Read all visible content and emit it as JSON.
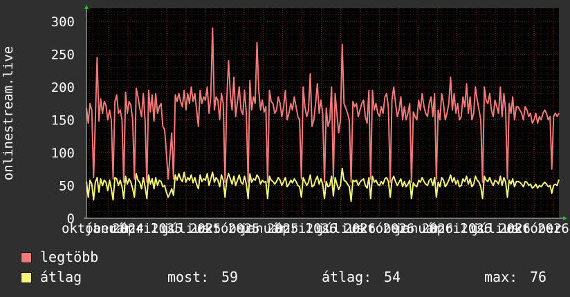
{
  "chart_data": {
    "type": "line",
    "ylabel": "onlinestream.live",
    "ylim": [
      0,
      320
    ],
    "yticks": [
      0,
      50,
      100,
      150,
      200,
      250,
      300
    ],
    "xticks": [
      "október",
      "január",
      "2024",
      "április",
      "2025",
      "július",
      "2025",
      "október",
      "2025",
      "január",
      "2025",
      "április",
      "2026",
      "július",
      "2026",
      "október",
      "2026",
      "január",
      "2026",
      "április",
      "2026",
      "július",
      "2026",
      "október",
      "2026"
    ],
    "grid": true,
    "colors": {
      "max": "#f07a7a",
      "avg": "#f5f57a",
      "background": "#2f2f2f",
      "plot": "#000000",
      "grid": "#7a2020",
      "axis_marker": "#00cc00"
    },
    "series": [
      {
        "name": "legtöbb",
        "color": "#f07a7a",
        "values": [
          168,
          145,
          175,
          165,
          62,
          150,
          245,
          148,
          182,
          160,
          178,
          172,
          150,
          165,
          150,
          60,
          178,
          188,
          160,
          165,
          150,
          55,
          192,
          160,
          178,
          172,
          150,
          60,
          198,
          185,
          168,
          155,
          190,
          150,
          55,
          195,
          162,
          188,
          148,
          190,
          160,
          170,
          175,
          140,
          135,
          100,
          60,
          95,
          130,
          60,
          188,
          178,
          190,
          178,
          170,
          195,
          165,
          190,
          175,
          200,
          178,
          190,
          165,
          140,
          195,
          175,
          185,
          180,
          200,
          160,
          185,
          290,
          165,
          185,
          180,
          150,
          190,
          175,
          55,
          180,
          240,
          188,
          165,
          215,
          155,
          178,
          200,
          165,
          158,
          195,
          160,
          55,
          210,
          165,
          185,
          175,
          268,
          195,
          165,
          180,
          162,
          170,
          55,
          195,
          178,
          175,
          160,
          165,
          185,
          175,
          155,
          170,
          195,
          150,
          160,
          175,
          165,
          185,
          170,
          155,
          150,
          60,
          200,
          170,
          155,
          165,
          220,
          140,
          150,
          175,
          205,
          160,
          180,
          160,
          55,
          168,
          140,
          150,
          200,
          60,
          190,
          160,
          130,
          150,
          265,
          175,
          168,
          160,
          150,
          55,
          178,
          170,
          175,
          155,
          165,
          175,
          180,
          155,
          145,
          195,
          60,
          195,
          165,
          175,
          160,
          155,
          170,
          160,
          185,
          190,
          168,
          55,
          180,
          200,
          175,
          155,
          165,
          185,
          150,
          170,
          150,
          160,
          175,
          55,
          162,
          155,
          150,
          180,
          165,
          190,
          170,
          160,
          155,
          175,
          185,
          155,
          190,
          60,
          165,
          150,
          190,
          175,
          150,
          160,
          175,
          215,
          165,
          190,
          160,
          175,
          150,
          155,
          185,
          170,
          205,
          160,
          185,
          150,
          160,
          200,
          180,
          165,
          150,
          55,
          200,
          180,
          175,
          190,
          165,
          155,
          180,
          170,
          160,
          200,
          155,
          190,
          165,
          60,
          175,
          160,
          185,
          150,
          170,
          170,
          165,
          160,
          150,
          170,
          165,
          155,
          160,
          145,
          150,
          160,
          145,
          155,
          150,
          160,
          165,
          160,
          150,
          155,
          75,
          155,
          160,
          155,
          160
        ]
      },
      {
        "name": "átlag",
        "color": "#f5f57a",
        "values": [
          56,
          32,
          58,
          52,
          28,
          55,
          62,
          40,
          60,
          50,
          58,
          55,
          42,
          58,
          45,
          28,
          62,
          60,
          50,
          58,
          48,
          30,
          64,
          52,
          60,
          55,
          45,
          32,
          68,
          58,
          55,
          45,
          62,
          48,
          30,
          66,
          52,
          60,
          45,
          62,
          50,
          58,
          56,
          48,
          50,
          40,
          32,
          38,
          45,
          35,
          66,
          58,
          68,
          60,
          56,
          70,
          55,
          62,
          58,
          66,
          54,
          62,
          52,
          45,
          66,
          56,
          60,
          58,
          68,
          50,
          60,
          70,
          55,
          62,
          58,
          48,
          66,
          58,
          32,
          58,
          68,
          60,
          52,
          64,
          50,
          58,
          66,
          55,
          52,
          64,
          52,
          30,
          68,
          55,
          60,
          58,
          66,
          62,
          52,
          58,
          55,
          56,
          30,
          64,
          58,
          56,
          52,
          56,
          62,
          58,
          50,
          56,
          62,
          48,
          52,
          58,
          54,
          60,
          56,
          50,
          48,
          32,
          62,
          56,
          50,
          55,
          66,
          48,
          50,
          58,
          64,
          52,
          60,
          52,
          30,
          56,
          48,
          50,
          64,
          34,
          62,
          52,
          44,
          50,
          76,
          58,
          56,
          52,
          48,
          26,
          58,
          56,
          58,
          50,
          55,
          58,
          60,
          50,
          46,
          62,
          30,
          64,
          55,
          58,
          52,
          50,
          56,
          52,
          60,
          62,
          56,
          32,
          58,
          64,
          56,
          50,
          55,
          60,
          48,
          56,
          48,
          52,
          58,
          30,
          54,
          50,
          48,
          58,
          55,
          62,
          56,
          52,
          50,
          58,
          60,
          50,
          62,
          32,
          55,
          48,
          62,
          58,
          48,
          52,
          58,
          66,
          55,
          62,
          52,
          58,
          48,
          50,
          60,
          56,
          64,
          52,
          60,
          48,
          52,
          64,
          58,
          55,
          48,
          30,
          64,
          58,
          56,
          62,
          55,
          50,
          58,
          56,
          52,
          64,
          50,
          62,
          55,
          32,
          58,
          52,
          60,
          48,
          56,
          56,
          55,
          52,
          48,
          56,
          55,
          50,
          52,
          46,
          48,
          52,
          46,
          50,
          48,
          52,
          55,
          52,
          48,
          50,
          38,
          50,
          52,
          50,
          59
        ]
      }
    ]
  },
  "legend": {
    "items": [
      {
        "label": "legtöbb",
        "color": "#f07a7a"
      },
      {
        "label": "átlag",
        "color": "#f5f57a"
      }
    ],
    "stats": {
      "now_label": "most:",
      "now_value": "59",
      "avg_label": "átlag:",
      "avg_value": "54",
      "max_label": "max:",
      "max_value": "76"
    }
  }
}
